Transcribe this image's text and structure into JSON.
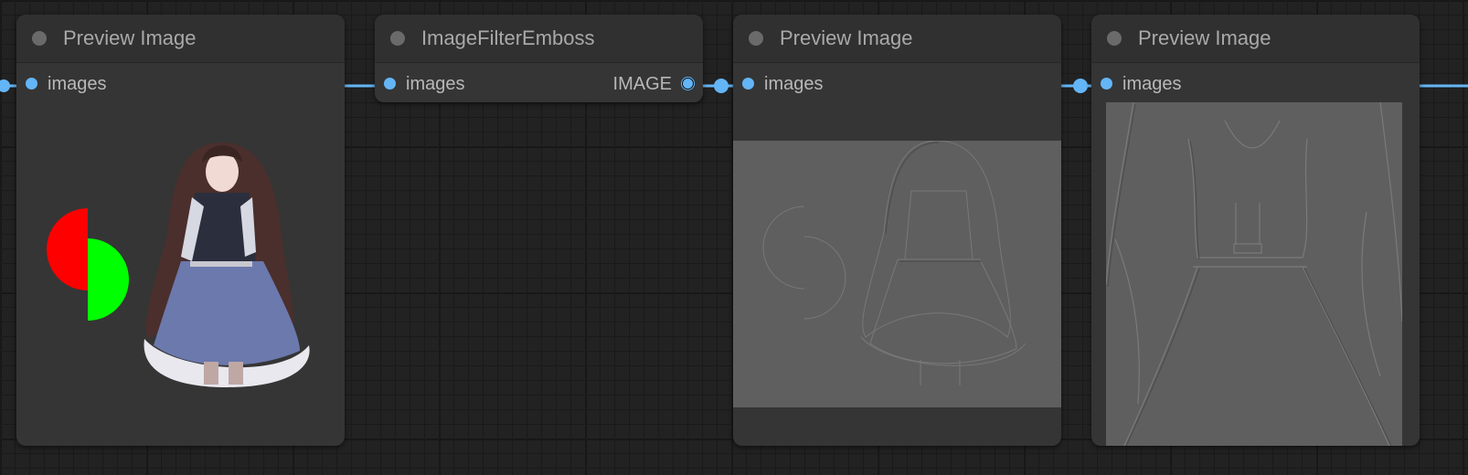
{
  "nodes": [
    {
      "title": "Preview Image",
      "inputs": [
        {
          "label": "images"
        }
      ],
      "preview": "original-image"
    },
    {
      "title": "ImageFilterEmboss",
      "inputs": [
        {
          "label": "images"
        }
      ],
      "outputs": [
        {
          "label": "IMAGE"
        }
      ]
    },
    {
      "title": "Preview Image",
      "inputs": [
        {
          "label": "images"
        }
      ],
      "preview": "embossed-image"
    },
    {
      "title": "Preview Image",
      "inputs": [
        {
          "label": "images"
        }
      ],
      "preview": "embossed-image-closeup"
    }
  ],
  "colors": {
    "canvas_background": "#222222",
    "node_body": "#353535",
    "node_title_bar": "#303030",
    "link_color": "#64b5f6",
    "emboss_gray": "#5f5f5f"
  }
}
